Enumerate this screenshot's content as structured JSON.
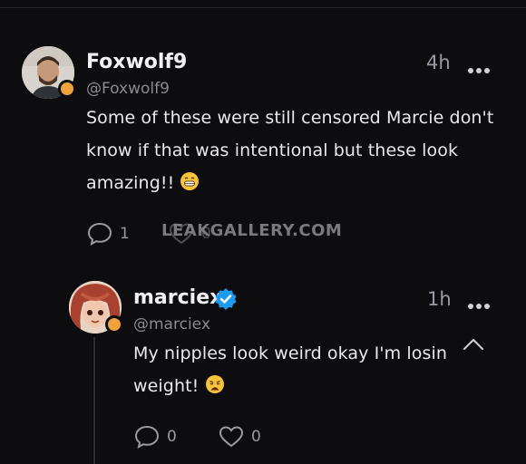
{
  "watermark": "LEAKGALLERY.COM",
  "post": {
    "author_name": "Foxwolf9",
    "handle": "@Foxwolf9",
    "time": "4h",
    "text": "Some of these were still censored Marcie don't know if that was intentional but these look amazing!!",
    "text_emoji": "grinning-face-emoji",
    "reply_count": "1",
    "like_count": "0"
  },
  "reply": {
    "author_name": "marciex",
    "handle": "@marciex",
    "time": "1h",
    "text": "My nipples look weird okay I'm losin weight!",
    "text_emoji": "weary-face-emoji",
    "reply_count": "0",
    "like_count": "0",
    "verified_color": "#1d9bf0"
  },
  "colors": {
    "background": "#0d0d0f",
    "status_dot": "#f0a33c",
    "muted": "#9a9aa2"
  }
}
